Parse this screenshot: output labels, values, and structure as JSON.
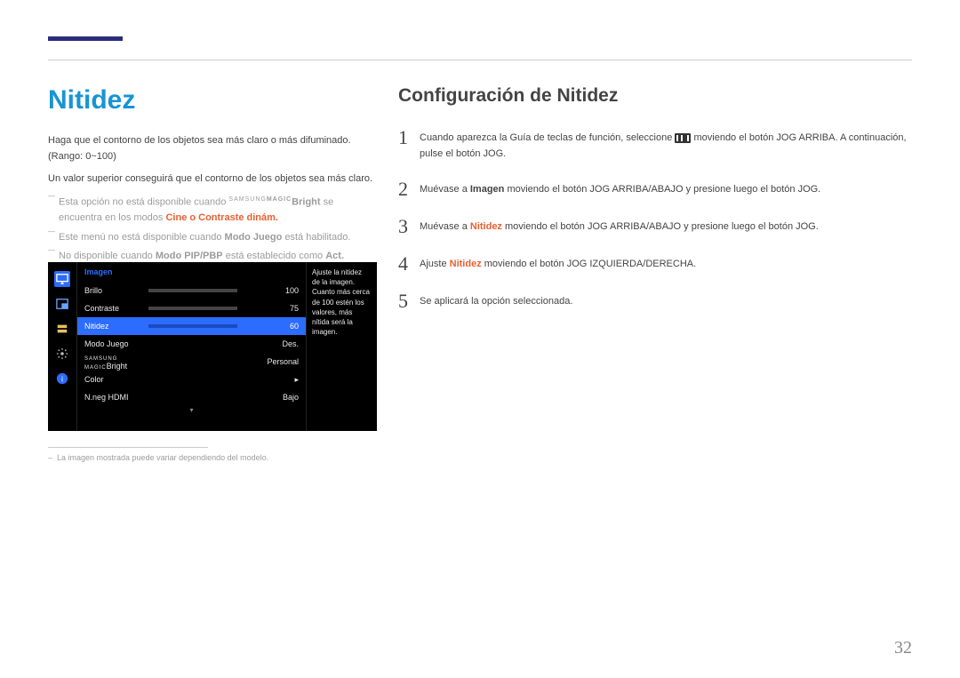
{
  "page_number": "32",
  "left": {
    "heading": "Nitidez",
    "intro": "Haga que el contorno de los objetos sea más claro o más difuminado. (Rango: 0~100)",
    "sub": "Un valor superior conseguirá que el contorno de los objetos sea más claro.",
    "note1_a": "Esta opción no está disponible cuando ",
    "note1_cat_pre": "SAMSUNG",
    "note1_cat": "MAGIC",
    "note1_bright": "Bright",
    "note1_b": " se encuentra en los modos ",
    "note1_modes": "Cine o Contraste dinám.",
    "note2_a": "Este menú no está disponible cuando ",
    "note2_bold": "Modo Juego",
    "note2_b": " está habilitado.",
    "note3_a": "No disponible cuando ",
    "note3_bold": "Modo PIP/PBP",
    "note3_b": " está establecido como ",
    "note3_act": "Act."
  },
  "right": {
    "heading": "Configuración de Nitidez",
    "steps": {
      "s1_a": "Cuando aparezca la Guía de teclas de función, seleccione ",
      "s1_b": " moviendo el botón JOG ARRIBA. A continuación, pulse el botón JOG.",
      "s2_a": "Muévase a ",
      "s2_bold": "Imagen",
      "s2_b": " moviendo el botón JOG ARRIBA/ABAJO y presione luego el botón JOG.",
      "s3_a": "Muévase a ",
      "s3_bold": "Nitidez",
      "s3_b": " moviendo el botón JOG ARRIBA/ABAJO y presione luego el botón JOG.",
      "s4_a": "Ajuste ",
      "s4_bold": "Nitidez",
      "s4_b": " moviendo el botón JOG IZQUIERDA/DERECHA.",
      "s5": "Se aplicará la opción seleccionada."
    }
  },
  "osd": {
    "header": "Imagen",
    "rows": {
      "brillo": {
        "label": "Brillo",
        "val": "100",
        "pct": 100
      },
      "contraste": {
        "label": "Contraste",
        "val": "75",
        "pct": 75
      },
      "nitidez": {
        "label": "Nitidez",
        "val": "60",
        "pct": 60
      },
      "modojuego": {
        "label": "Modo Juego",
        "val": "Des."
      },
      "magic_pre": "SAMSUNG",
      "magic_mid": "MAGIC",
      "magic_suf": "Bright",
      "magic_val": "Personal",
      "color": {
        "label": "Color",
        "val": "▸"
      },
      "nneg": {
        "label": "N.neg HDMI",
        "val": "Bajo"
      }
    },
    "desc": "Ajuste la nitidez de la imagen. Cuanto más cerca de 100 estén los valores, más nítida será la imagen."
  },
  "footnote": "La imagen mostrada puede variar dependiendo del modelo."
}
